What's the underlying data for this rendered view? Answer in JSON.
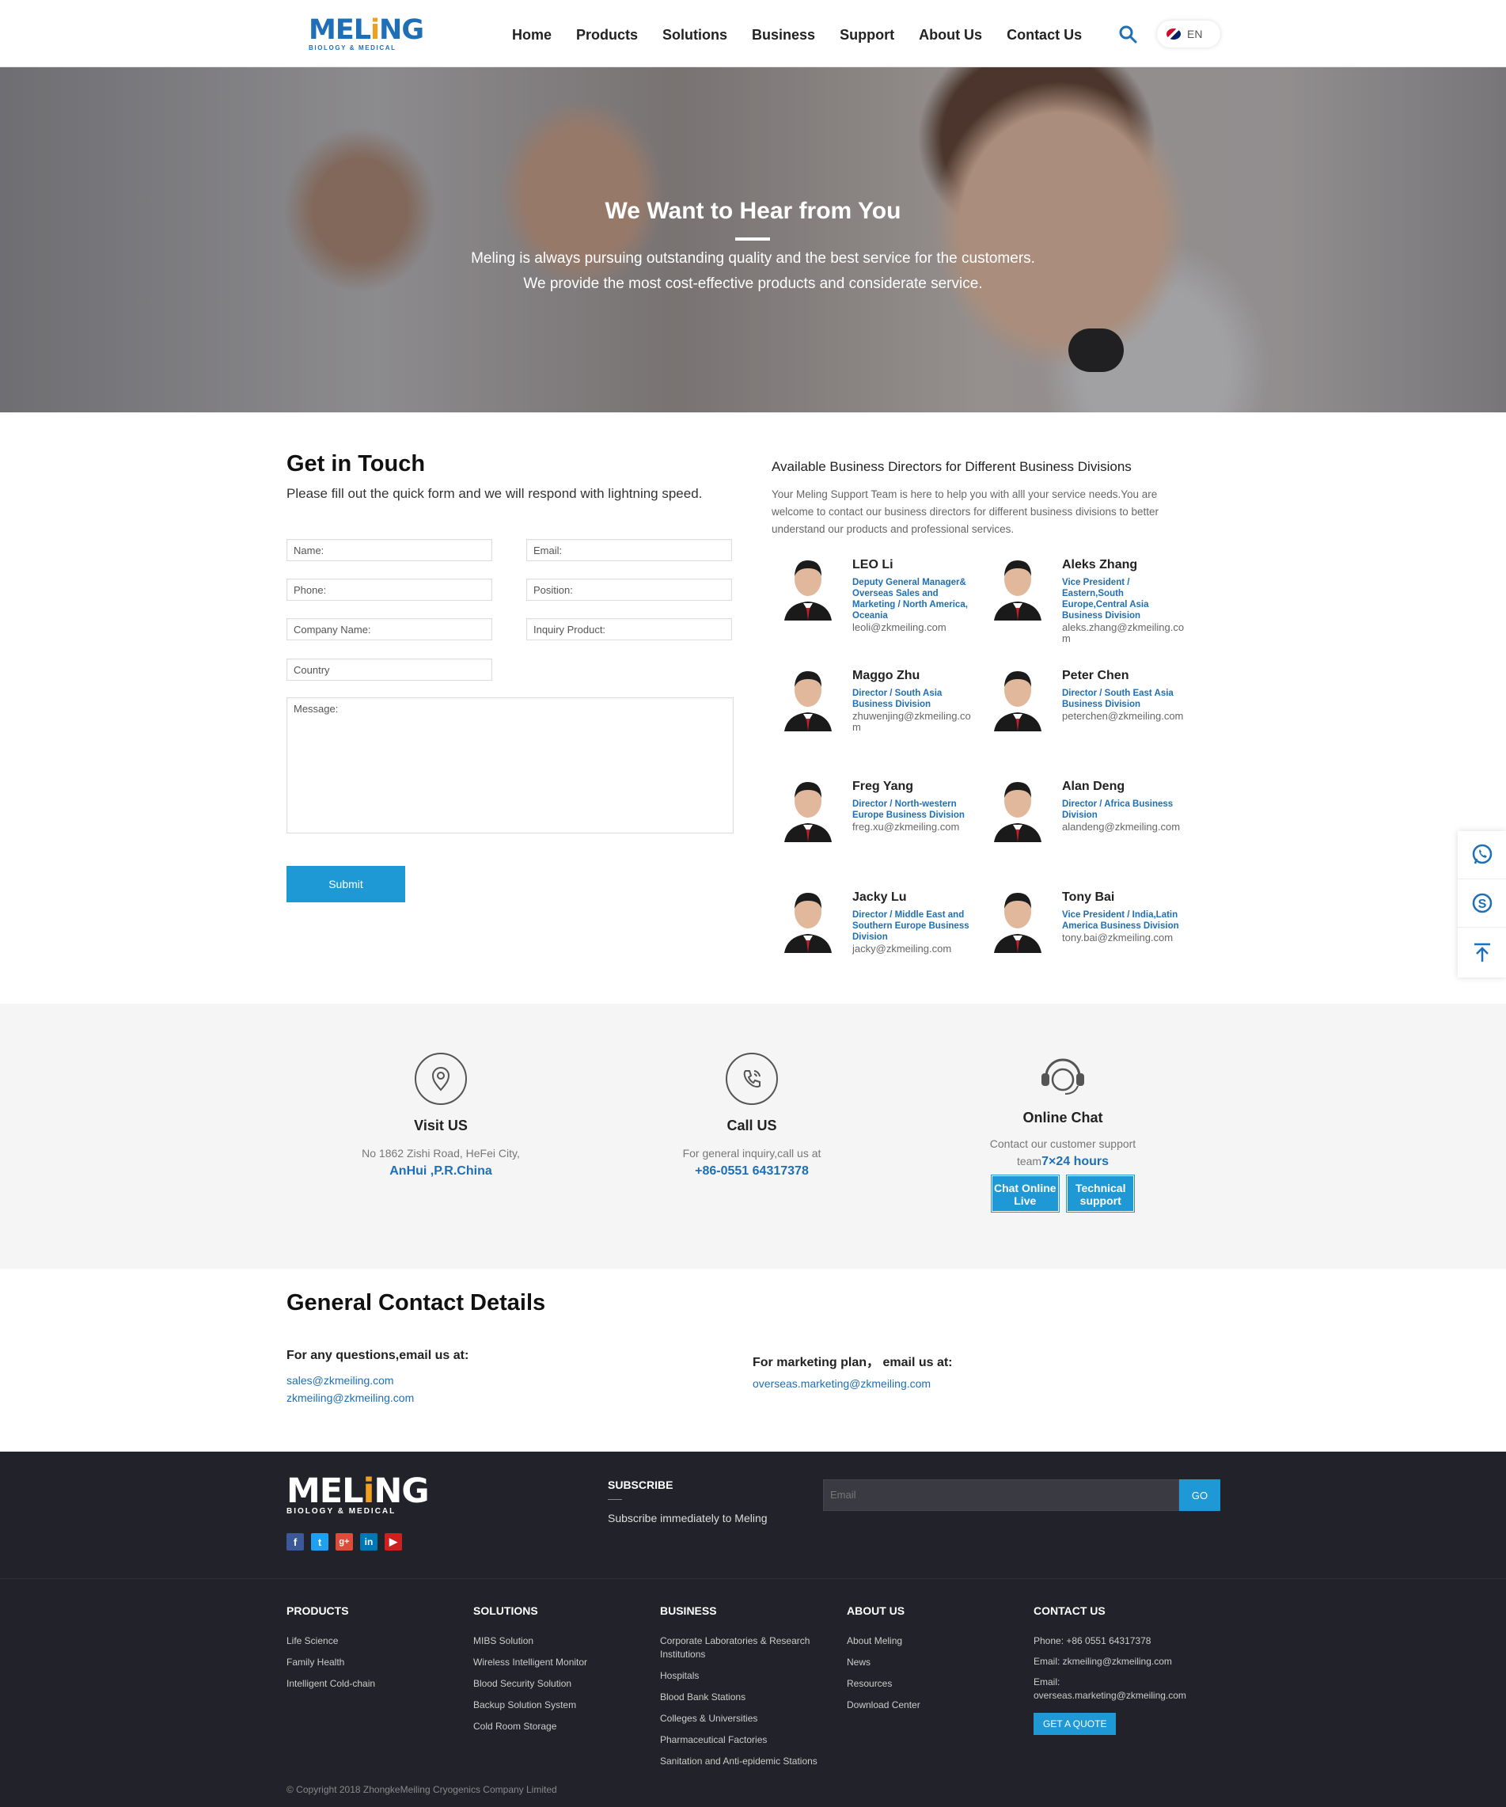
{
  "header": {
    "logo_word_a": "MEL",
    "logo_word_b": "i",
    "logo_word_c": "NG",
    "logo_sub": "BIOLOGY & MEDICAL",
    "nav": [
      "Home",
      "Products",
      "Solutions",
      "Business",
      "Support",
      "About Us",
      "Contact Us"
    ],
    "lang": "EN"
  },
  "hero": {
    "title": "We Want to Hear from You",
    "line1": "Meling is always pursuing outstanding quality and the best service for the customers.",
    "line2": "We provide the most cost-effective products and considerate service."
  },
  "form": {
    "title": "Get in Touch",
    "subtitle": "Please fill out the quick form and we will respond with lightning speed.",
    "fields": {
      "name": "Name:",
      "email": "Email:",
      "phone": "Phone:",
      "position": "Position:",
      "company": "Company Name:",
      "product": "Inquiry Product:",
      "country": "Country",
      "message": "Message:"
    },
    "submit": "Submit"
  },
  "directors": {
    "title": "Available Business Directors for Different Business Divisions",
    "intro": "Your Meling Support Team is here to help you with alll your service needs.You are welcome to contact our business directors for different business divisions to better understand our products and professional services.",
    "people": [
      {
        "name": "LEO Li",
        "role": "Deputy General Manager& Overseas Sales and Marketing / North America, Oceania",
        "email": "leoli@zkmeiling.com"
      },
      {
        "name": "Aleks Zhang",
        "role": "Vice President / Eastern,South Europe,Central Asia Business Division",
        "email": "aleks.zhang@zkmeiling.com"
      },
      {
        "name": "Maggo Zhu",
        "role": "Director / South Asia Business Division",
        "email": "zhuwenjing@zkmeiling.com"
      },
      {
        "name": "Peter Chen",
        "role": "Director / South East Asia Business Division",
        "email": "peterchen@zkmeiling.com"
      },
      {
        "name": "Freg Yang",
        "role": "Director / North-western Europe Business Division",
        "email": "freg.xu@zkmeiling.com"
      },
      {
        "name": "Alan Deng",
        "role": "Director / Africa Business Division",
        "email": "alandeng@zkmeiling.com"
      },
      {
        "name": "Jacky Lu",
        "role": "Director / Middle East and Southern Europe Business Division",
        "email": "jacky@zkmeiling.com"
      },
      {
        "name": "Tony Bai",
        "role": "Vice President / India,Latin America Business Division",
        "email": "tony.bai@zkmeiling.com"
      }
    ]
  },
  "contact_band": {
    "visit": {
      "title": "Visit US",
      "text": "No 1862 Zishi Road, HeFei City,",
      "strong": "AnHui ,P.R.China"
    },
    "call": {
      "title": "Call US",
      "text": "For general inquiry,call us at",
      "strong": "+86-0551 64317378"
    },
    "chat": {
      "title": "Online Chat",
      "text": "Contact our customer support",
      "team": "team",
      "strong": "7×24 hours",
      "btn1_a": "Chat Online",
      "btn1_b": "Live",
      "btn2_a": "Technical",
      "btn2_b": "support"
    }
  },
  "general": {
    "title": "General Contact Details",
    "q1": "For any questions,email us at:",
    "m1": "sales@zkmeiling.com",
    "m2": "zkmeiling@zkmeiling.com",
    "q2": "For marketing plan， email us at:",
    "m3": "overseas.marketing@zkmeiling.com"
  },
  "footer": {
    "logo_word_a": "MEL",
    "logo_word_b": "i",
    "logo_word_c": "NG",
    "logo_sub": "BIOLOGY & MEDICAL",
    "subscribe_title": "SUBSCRIBE",
    "subscribe_text": "Subscribe immediately to Meling",
    "email_placeholder": "Email",
    "go": "GO",
    "columns": [
      {
        "title": "PRODUCTS",
        "items": [
          "Life Science",
          "Family Health",
          "Intelligent Cold-chain"
        ]
      },
      {
        "title": "SOLUTIONS",
        "items": [
          "MIBS Solution",
          "Wireless Intelligent Monitor",
          "Blood Security Solution",
          "Backup Solution System",
          "Cold Room Storage"
        ]
      },
      {
        "title": "BUSINESS",
        "items": [
          "Corporate Laboratories & Research Institutions",
          "Hospitals",
          "Blood Bank Stations",
          "Colleges & Universities",
          "Pharmaceutical Factories",
          "Sanitation and Anti-epidemic Stations"
        ]
      },
      {
        "title": "ABOUT US",
        "items": [
          "About Meling",
          "News",
          "Resources",
          "Download Center"
        ]
      },
      {
        "title": "CONTACT US",
        "items": [
          "Phone: +86 0551 64317378",
          "Email: zkmeiling@zkmeiling.com",
          "Email: overseas.marketing@zkmeiling.com"
        ]
      }
    ],
    "quote": "GET A QUOTE",
    "copyright": "© Copyright 2018 ZhongkeMeiling Cryogenics Company Limited"
  },
  "colors": {
    "accent": "#1f99d6",
    "brand_blue": "#1e6fb6",
    "brand_orange": "#f0a020",
    "footer_bg": "#22232a"
  }
}
